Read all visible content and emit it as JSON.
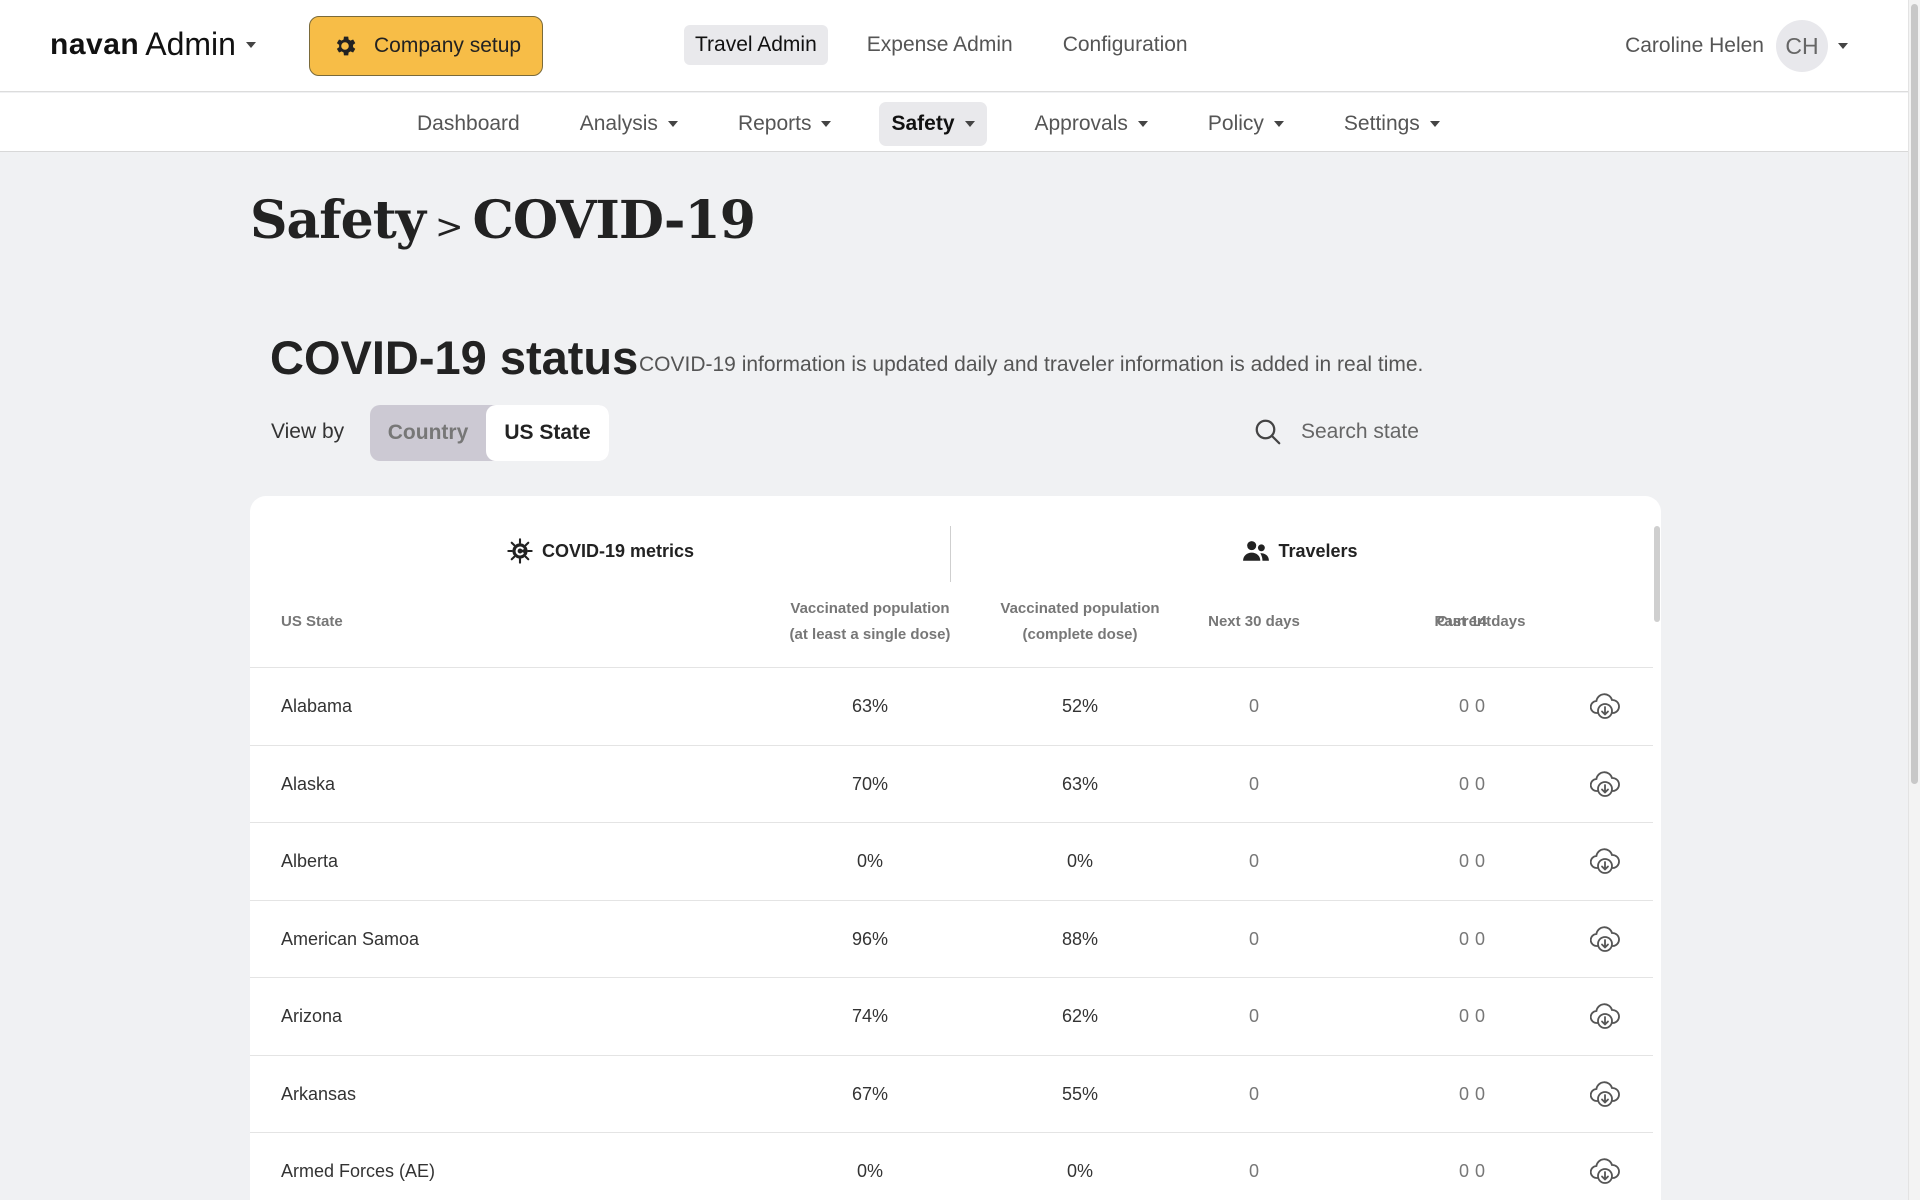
{
  "topbar": {
    "brand": "navan",
    "app": "Admin",
    "company_setup": "Company setup",
    "nav": [
      "Travel Admin",
      "Expense Admin",
      "Configuration"
    ],
    "active_nav": "Travel Admin",
    "user_name": "Caroline Helen",
    "user_initials": "CH"
  },
  "subnav": {
    "items": [
      "Dashboard",
      "Analysis",
      "Reports",
      "Safety",
      "Approvals",
      "Policy",
      "Settings"
    ],
    "active": "Safety"
  },
  "page": {
    "breadcrumb_parent": "Safety",
    "breadcrumb_sep": ">",
    "breadcrumb_current": "COVID-19",
    "status_title": "COVID-19 status",
    "status_subtitle": "COVID-19 information is updated daily and traveler information is added in real time.",
    "view_by_label": "View by",
    "toggle_country": "Country",
    "toggle_state": "US State",
    "search_placeholder": "Search state"
  },
  "table": {
    "group_metrics": "COVID-19 metrics",
    "group_travelers": "Travelers",
    "columns": {
      "state": "US State",
      "vax_single_1": "Vaccinated population",
      "vax_single_2": "(at least a single dose)",
      "vax_full_1": "Vaccinated population",
      "vax_full_2": "(complete dose)",
      "next30": "Next 30 days",
      "current": "Current",
      "past14": "Past 14 days"
    },
    "rows": [
      {
        "state": "Alabama",
        "single": "63%",
        "full": "52%",
        "next30": "0",
        "current": "0",
        "past14": "0"
      },
      {
        "state": "Alaska",
        "single": "70%",
        "full": "63%",
        "next30": "0",
        "current": "0",
        "past14": "0"
      },
      {
        "state": "Alberta",
        "single": "0%",
        "full": "0%",
        "next30": "0",
        "current": "0",
        "past14": "0"
      },
      {
        "state": "American Samoa",
        "single": "96%",
        "full": "88%",
        "next30": "0",
        "current": "0",
        "past14": "0"
      },
      {
        "state": "Arizona",
        "single": "74%",
        "full": "62%",
        "next30": "0",
        "current": "0",
        "past14": "0"
      },
      {
        "state": "Arkansas",
        "single": "67%",
        "full": "55%",
        "next30": "0",
        "current": "0",
        "past14": "0"
      },
      {
        "state": "Armed Forces (AE)",
        "single": "0%",
        "full": "0%",
        "next30": "0",
        "current": "0",
        "past14": "0"
      }
    ]
  },
  "colors": {
    "accent": "#f7bd47",
    "background": "#f0f1f3"
  }
}
